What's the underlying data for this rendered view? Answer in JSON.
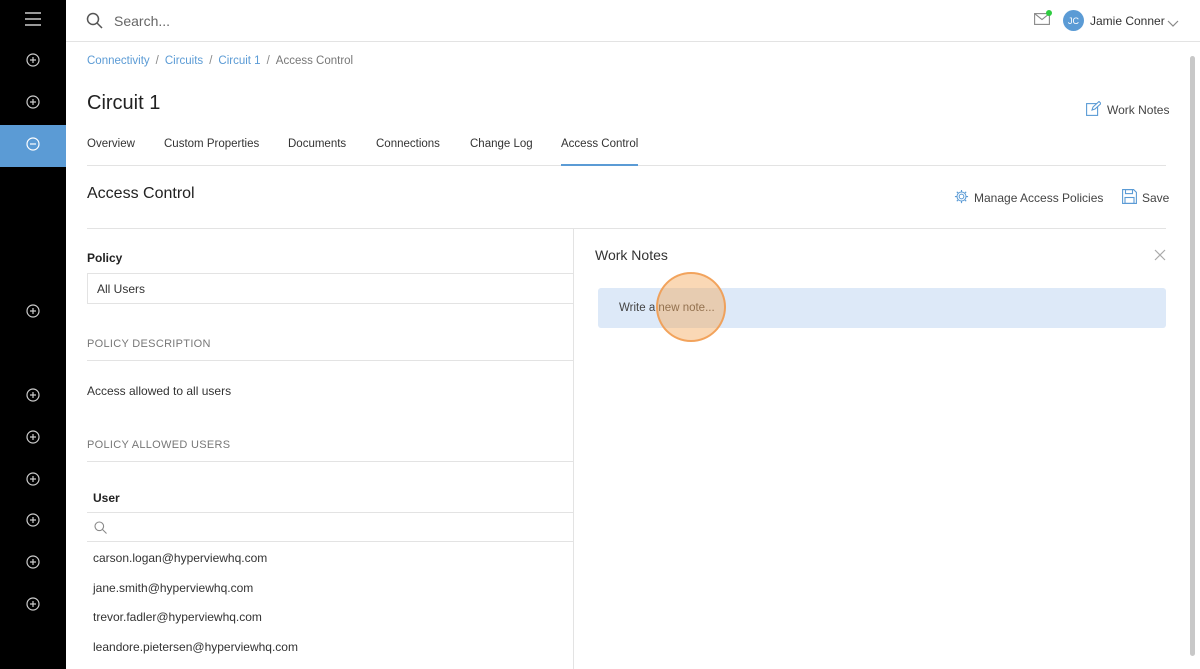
{
  "sidebar": {
    "items": [
      {
        "icon": "menu-icon"
      },
      {
        "icon": "plus-circle-icon"
      },
      {
        "icon": "plus-circle-icon"
      },
      {
        "icon": "minus-circle-icon",
        "active": true
      },
      {
        "icon": "plus-circle-icon"
      },
      {
        "icon": "plus-circle-icon"
      },
      {
        "icon": "plus-circle-icon"
      },
      {
        "icon": "plus-circle-icon"
      },
      {
        "icon": "plus-circle-icon"
      },
      {
        "icon": "plus-circle-icon"
      },
      {
        "icon": "plus-circle-icon"
      }
    ],
    "accent": "#5b9bd5"
  },
  "topbar": {
    "search_placeholder": "Search...",
    "user_initials": "JC",
    "user_name": "Jamie Conner",
    "notification_dot_color": "#2ecc40"
  },
  "breadcrumb": {
    "items": [
      "Connectivity",
      "Circuits",
      "Circuit 1",
      "Access Control"
    ],
    "separator": "/"
  },
  "page": {
    "title": "Circuit 1",
    "work_notes_link": "Work Notes"
  },
  "tabs": [
    "Overview",
    "Custom Properties",
    "Documents",
    "Connections",
    "Change Log",
    "Access Control"
  ],
  "active_tab": "Access Control",
  "section": {
    "title": "Access Control",
    "manage_label": "Manage Access Policies",
    "save_label": "Save"
  },
  "policy": {
    "label": "Policy",
    "value": "All Users",
    "description_heading": "POLICY DESCRIPTION",
    "description": "Access allowed to all users",
    "allowed_heading": "POLICY ALLOWED USERS",
    "user_column": "User",
    "users": [
      "carson.logan@hyperviewhq.com",
      "jane.smith@hyperviewhq.com",
      "trevor.fadler@hyperviewhq.com",
      "leandore.pietersen@hyperviewhq.com"
    ]
  },
  "work_notes": {
    "title": "Work Notes",
    "placeholder": "Write a new note..."
  }
}
